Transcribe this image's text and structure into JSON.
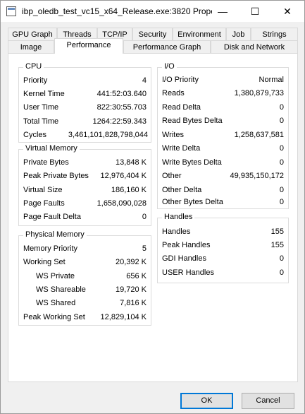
{
  "window": {
    "title": "ibp_oledb_test_vc15_x64_Release.exe:3820 Prope...",
    "minimize_glyph": "—",
    "maximize_glyph": "☐",
    "close_glyph": "✕"
  },
  "tabs_row1": [
    "GPU Graph",
    "Threads",
    "TCP/IP",
    "Security",
    "Environment",
    "Job",
    "Strings"
  ],
  "tabs_row2": [
    "Image",
    "Performance",
    "Performance Graph",
    "Disk and Network"
  ],
  "active_tab": "Performance",
  "cpu": {
    "title": "CPU",
    "rows": [
      {
        "label": "Priority",
        "value": "4"
      },
      {
        "label": "Kernel Time",
        "value": "441:52:03.640"
      },
      {
        "label": "User Time",
        "value": "822:30:55.703"
      },
      {
        "label": "Total Time",
        "value": "1264:22:59.343"
      },
      {
        "label": "Cycles",
        "value": "3,461,101,828,798,044"
      }
    ]
  },
  "virtual_memory": {
    "title": "Virtual Memory",
    "rows": [
      {
        "label": "Private Bytes",
        "value": "13,848 K"
      },
      {
        "label": "Peak Private Bytes",
        "value": "12,976,404 K"
      },
      {
        "label": "Virtual Size",
        "value": "186,160 K"
      },
      {
        "label": "Page Faults",
        "value": "1,658,090,028"
      },
      {
        "label": "Page Fault Delta",
        "value": "0"
      }
    ]
  },
  "physical_memory": {
    "title": "Physical Memory",
    "rows": [
      {
        "label": "Memory Priority",
        "value": "5"
      },
      {
        "label": "Working Set",
        "value": "20,392 K"
      },
      {
        "label": "WS Private",
        "value": "656 K"
      },
      {
        "label": "WS Shareable",
        "value": "19,720 K"
      },
      {
        "label": "WS Shared",
        "value": "7,816 K"
      },
      {
        "label": "Peak Working Set",
        "value": "12,829,104 K"
      }
    ]
  },
  "io": {
    "title": "I/O",
    "rows": [
      {
        "label": "I/O Priority",
        "value": "Normal"
      },
      {
        "label": "Reads",
        "value": "1,380,879,733"
      },
      {
        "label": "Read Delta",
        "value": "0"
      },
      {
        "label": "Read Bytes Delta",
        "value": "0"
      },
      {
        "label": "Writes",
        "value": "1,258,637,581"
      },
      {
        "label": "Write Delta",
        "value": "0"
      },
      {
        "label": "Write Bytes Delta",
        "value": "0"
      },
      {
        "label": "Other",
        "value": "49,935,150,172"
      },
      {
        "label": "Other Delta",
        "value": "0"
      },
      {
        "label": "Other Bytes Delta",
        "value": "0"
      }
    ]
  },
  "handles": {
    "title": "Handles",
    "rows": [
      {
        "label": "Handles",
        "value": "155"
      },
      {
        "label": "Peak Handles",
        "value": "155"
      },
      {
        "label": "GDI Handles",
        "value": "0"
      },
      {
        "label": "USER Handles",
        "value": "0"
      }
    ]
  },
  "buttons": {
    "ok": "OK",
    "cancel": "Cancel"
  }
}
